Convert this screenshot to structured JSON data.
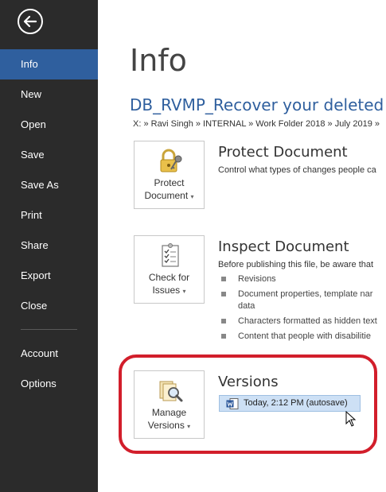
{
  "sidebar": {
    "items": [
      {
        "label": "Info",
        "active": true
      },
      {
        "label": "New"
      },
      {
        "label": "Open"
      },
      {
        "label": "Save"
      },
      {
        "label": "Save As"
      },
      {
        "label": "Print"
      },
      {
        "label": "Share"
      },
      {
        "label": "Export"
      },
      {
        "label": "Close"
      },
      {
        "label": "Account"
      },
      {
        "label": "Options"
      }
    ]
  },
  "main": {
    "title": "Info",
    "document_title": "DB_RVMP_Recover your deleted wo",
    "path": "X: » Ravi Singh » INTERNAL » Work Folder 2018 » July 2019 »",
    "protect": {
      "button_line1": "Protect",
      "button_line2": "Document",
      "heading": "Protect Document",
      "description": "Control what types of changes people ca"
    },
    "inspect": {
      "button_line1": "Check for",
      "button_line2": "Issues",
      "heading": "Inspect Document",
      "description": "Before publishing this file, be aware that",
      "bullets": [
        "Revisions",
        "Document properties, template nar",
        "data",
        "Characters formatted as hidden text",
        "Content that people with disabilitie"
      ]
    },
    "versions": {
      "button_line1": "Manage",
      "button_line2": "Versions",
      "heading": "Versions",
      "version_label": "Today, 2:12 PM (autosave)"
    }
  },
  "colors": {
    "sidebar_bg": "#2b2b2b",
    "active_item": "#2f5f9e",
    "accent": "#2f5f9e",
    "highlight": "#d21e2b"
  },
  "icons": {
    "back": "back-arrow-icon",
    "protect": "lock-key-icon",
    "inspect": "checklist-icon",
    "versions": "document-search-icon",
    "version_item": "word-document-icon"
  }
}
